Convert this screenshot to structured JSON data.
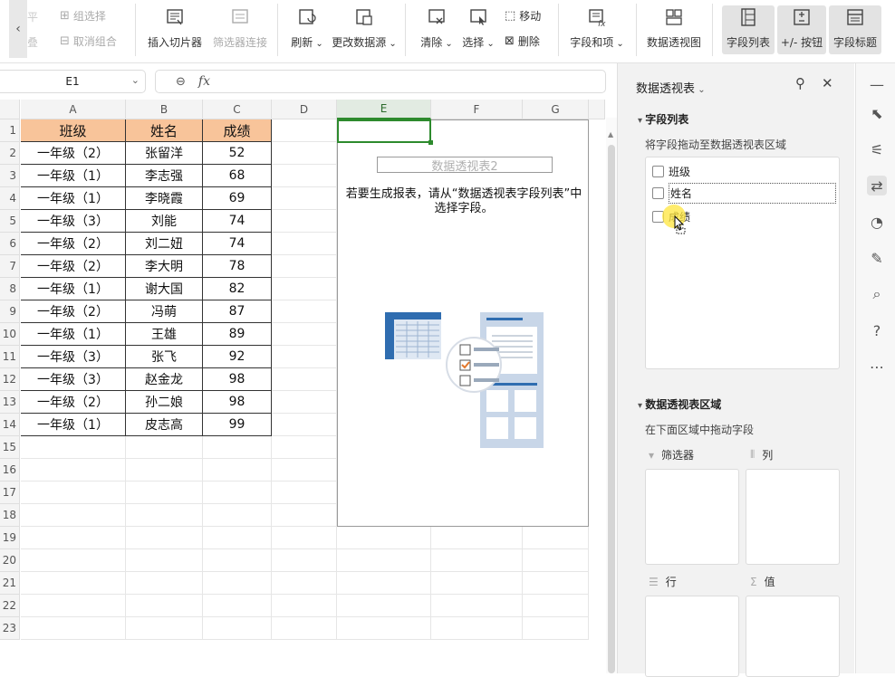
{
  "ribbon": {
    "group_select": "组选择",
    "cancel_group": "取消组合",
    "faded_top": "平",
    "faded_bottom": "叠",
    "insert_slicer": "插入切片器",
    "filter_connect": "筛选器连接",
    "refresh": "刷新",
    "change_source": "更改数据源",
    "clear": "清除",
    "select": "选择",
    "move": "移动",
    "delete": "删除",
    "fields_items": "字段和项",
    "pivot_view": "数据透视图",
    "field_list": "字段列表",
    "plus_minus": "+/- 按钮",
    "field_headers": "字段标题"
  },
  "formula_bar": {
    "cell_ref": "E1",
    "fx": "fx",
    "value": ""
  },
  "sheet": {
    "columns": [
      "A",
      "B",
      "C",
      "D",
      "E",
      "F",
      "G"
    ],
    "rows": [
      "1",
      "2",
      "3",
      "4",
      "5",
      "6",
      "7",
      "8",
      "9",
      "10",
      "11",
      "12",
      "13",
      "14",
      "15",
      "16",
      "17",
      "18",
      "19",
      "20",
      "21",
      "22",
      "23"
    ],
    "headers": [
      "班级",
      "姓名",
      "成绩"
    ],
    "data": [
      [
        "一年级（2）",
        "张留洋",
        "52"
      ],
      [
        "一年级（1）",
        "李志强",
        "68"
      ],
      [
        "一年级（1）",
        "李晓霞",
        "69"
      ],
      [
        "一年级（3）",
        "刘能",
        "74"
      ],
      [
        "一年级（2）",
        "刘二妞",
        "74"
      ],
      [
        "一年级（2）",
        "李大明",
        "78"
      ],
      [
        "一年级（1）",
        "谢大国",
        "82"
      ],
      [
        "一年级（2）",
        "冯萌",
        "87"
      ],
      [
        "一年级（1）",
        "王雄",
        "89"
      ],
      [
        "一年级（3）",
        "张飞",
        "92"
      ],
      [
        "一年级（3）",
        "赵金龙",
        "98"
      ],
      [
        "一年级（2）",
        "孙二娘",
        "98"
      ],
      [
        "一年级（1）",
        "皮志高",
        "99"
      ]
    ],
    "header_fill": "#f8c49a"
  },
  "pivot": {
    "name": "数据透视表2",
    "hint": "若要生成报表，请从“数据透视表字段列表”中选择字段。"
  },
  "panel": {
    "title": "数据透视表",
    "field_section": "字段列表",
    "field_hint": "将字段拖动至数据透视表区域",
    "fields": [
      "班级",
      "姓名",
      "成绩"
    ],
    "area_section": "数据透视表区域",
    "area_hint": "在下面区域中拖动字段",
    "areas": {
      "filter": "筛选器",
      "columns": "列",
      "rows": "行",
      "values": "值"
    }
  },
  "colors": {
    "accent_green": "#2d8a2d",
    "highlight": "#ffe63c"
  }
}
